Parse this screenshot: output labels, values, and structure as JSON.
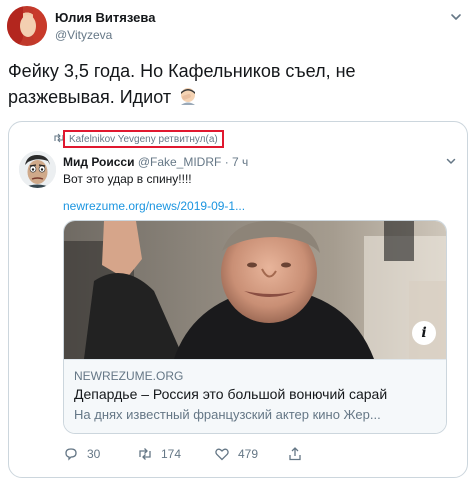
{
  "author": {
    "name": "Юлия Витязева",
    "handle": "@Vityzeva"
  },
  "tweet_text": "Фейку 3,5 года. Но Кафельников съел, не разжевывая. Идиот",
  "tweet_emoji": "facepalm-emoji",
  "quoted": {
    "retweet_note": "Kafelnikov Yevgeny ретвитнул(а)",
    "name": "Мид Роисси",
    "handle": "@Fake_MIDRF",
    "time": "· 7 ч",
    "text": "Вот это удар в спину!!!!",
    "link": "newrezume.org/news/2019-09-1...",
    "card": {
      "domain": "NEWREZUME.ORG",
      "title": "Депардье – Россия это большой вонючий сарай",
      "description": "На днях известный французский актер кино Жер...",
      "info_label": "i"
    },
    "actions": {
      "replies": "30",
      "retweets": "174",
      "likes": "479"
    }
  },
  "colors": {
    "link": "#1b95e0",
    "highlight_box": "#e0182f",
    "muted": "#657786",
    "border": "#ccd6dd"
  }
}
